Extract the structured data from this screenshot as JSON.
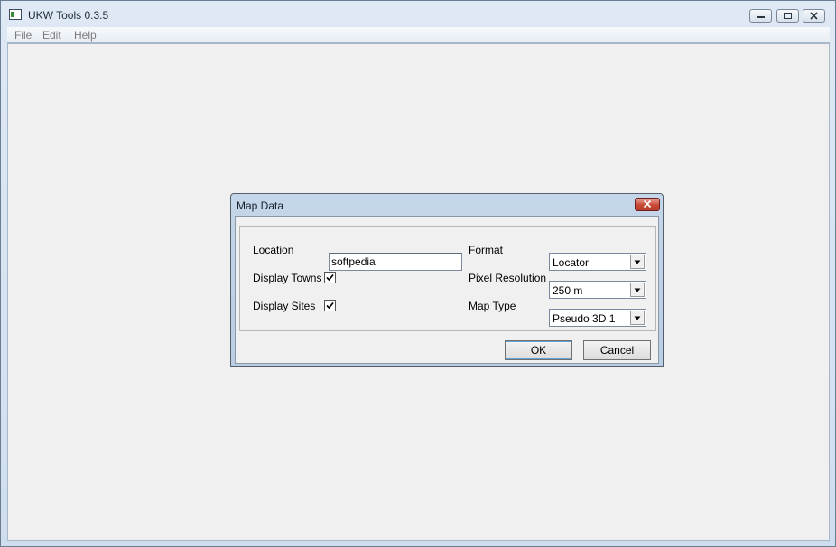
{
  "window": {
    "title": "UKW Tools 0.3.5",
    "icons": {
      "app": "app-icon",
      "minimize": "minimize-icon",
      "maximize": "maximize-icon",
      "close": "close-icon"
    }
  },
  "menubar": {
    "items": [
      {
        "label": "File"
      },
      {
        "label": "Edit"
      },
      {
        "label": "Help"
      }
    ]
  },
  "dialog": {
    "title": "Map Data",
    "fields": {
      "location": {
        "label": "Location",
        "value": "softpedia"
      },
      "display_towns": {
        "label": "Display Towns",
        "checked": true
      },
      "display_sites": {
        "label": "Display Sites",
        "checked": true
      },
      "format": {
        "label": "Format",
        "value": "Locator"
      },
      "pixel_resolution": {
        "label": "Pixel Resolution",
        "value": "250 m"
      },
      "map_type": {
        "label": "Map Type",
        "value": "Pseudo 3D 1"
      }
    },
    "buttons": {
      "ok": "OK",
      "cancel": "Cancel"
    }
  },
  "colors": {
    "client_bg": "#f0f0f0",
    "frame": "#cfdeef",
    "close_red": "#c74a36",
    "focus_blue": "#5fa2d8"
  }
}
